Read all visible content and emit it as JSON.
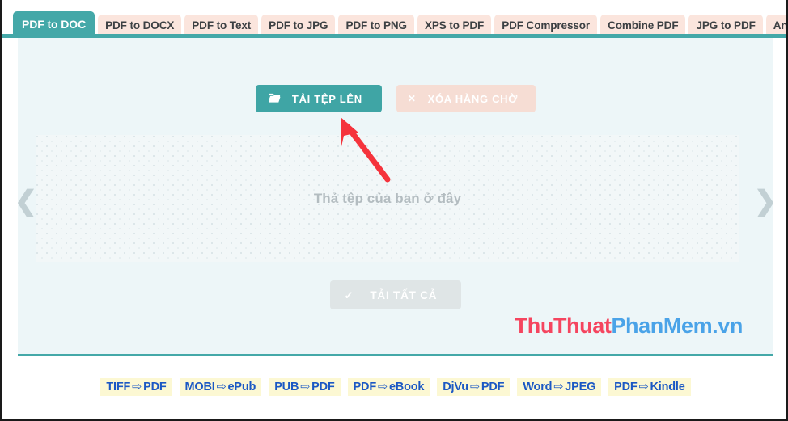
{
  "tabs": [
    {
      "label": "PDF to DOC",
      "active": true
    },
    {
      "label": "PDF to DOCX",
      "active": false
    },
    {
      "label": "PDF to Text",
      "active": false
    },
    {
      "label": "PDF to JPG",
      "active": false
    },
    {
      "label": "PDF to PNG",
      "active": false
    },
    {
      "label": "XPS to PDF",
      "active": false
    },
    {
      "label": "PDF Compressor",
      "active": false
    },
    {
      "label": "Combine PDF",
      "active": false
    },
    {
      "label": "JPG to PDF",
      "active": false
    },
    {
      "label": "Any to PDF",
      "active": false
    }
  ],
  "actions": {
    "upload_label": "TẢI TỆP LÊN",
    "upload_icon": "open-folder-icon",
    "upload_icon_glyph": "🗁",
    "clear_label": "XÓA HÀNG CHỜ",
    "clear_icon": "close-x-icon",
    "clear_icon_glyph": "✕",
    "download_label": "TẢI TẤT CẢ",
    "download_icon": "check-icon",
    "download_icon_glyph": "✓"
  },
  "dropzone": {
    "placeholder": "Thả tệp của bạn ở đây",
    "prev_arrow": "❮",
    "next_arrow": "❯"
  },
  "watermark": {
    "part_one": "ThuThuat",
    "part_two": "PhanMem.vn",
    "color_one": "#f5455f",
    "color_two": "#4aa3e8"
  },
  "annotation": {
    "type": "arrow",
    "color": "#f5333c",
    "points_to": "upload-button"
  },
  "footer_links": [
    {
      "from": "TIFF",
      "arrow": "⇨",
      "to": "PDF"
    },
    {
      "from": "MOBI",
      "arrow": "⇨",
      "to": "ePub"
    },
    {
      "from": "PUB",
      "arrow": "⇨",
      "to": "PDF"
    },
    {
      "from": "PDF",
      "arrow": "⇨",
      "to": "eBook"
    },
    {
      "from": "DjVu",
      "arrow": "⇨",
      "to": "PDF"
    },
    {
      "from": "Word",
      "arrow": "⇨",
      "to": "JPEG"
    },
    {
      "from": "PDF",
      "arrow": "⇨",
      "to": "Kindle"
    }
  ],
  "theme": {
    "accent": "#44a8a8",
    "tab_inactive_bg": "#fbe5dd",
    "panel_bg": "#edf6f8",
    "link_bg": "#fcf8d3",
    "link_text": "#1b58c4"
  }
}
